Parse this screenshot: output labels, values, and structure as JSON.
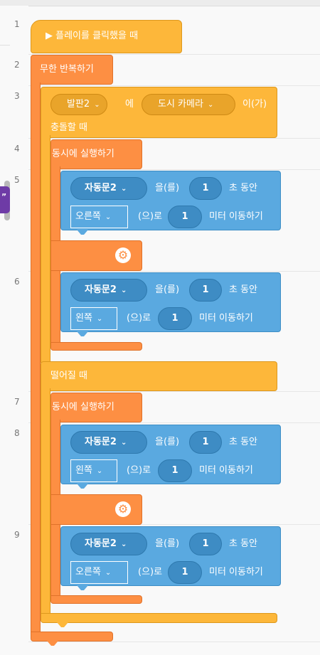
{
  "line_numbers": [
    "1",
    "2",
    "3",
    "4",
    "5",
    "6",
    "7",
    "8",
    "9"
  ],
  "side_tab_mark": "”",
  "blocks": {
    "start_label": "▶ 플레이를 클릭했을 때",
    "repeat_label": "무한 반복하기",
    "collision": {
      "object": "발판2",
      "connector": "에",
      "target": "도시 카메라",
      "suffix": "이(가)",
      "when_collide": "충돌할 때",
      "when_separate": "떨어질 때"
    },
    "parallel_label": "동시에 실행하기",
    "move": {
      "object": "자동문2",
      "particle": "을(를)",
      "seconds": "1",
      "seconds_label": "초 동안",
      "direction_particle": "(으)로",
      "distance": "1",
      "distance_label": "미터 이동하기",
      "dir_right": "오른쪽",
      "dir_left": "왼쪽"
    }
  },
  "colors": {
    "event_yellow": "#fdb73a",
    "control_orange": "#fd8f43",
    "motion_blue": "#5aa9e0"
  },
  "icons": {
    "gear": "gear-icon",
    "play": "play-icon",
    "dropdown": "chevron-down-icon"
  }
}
